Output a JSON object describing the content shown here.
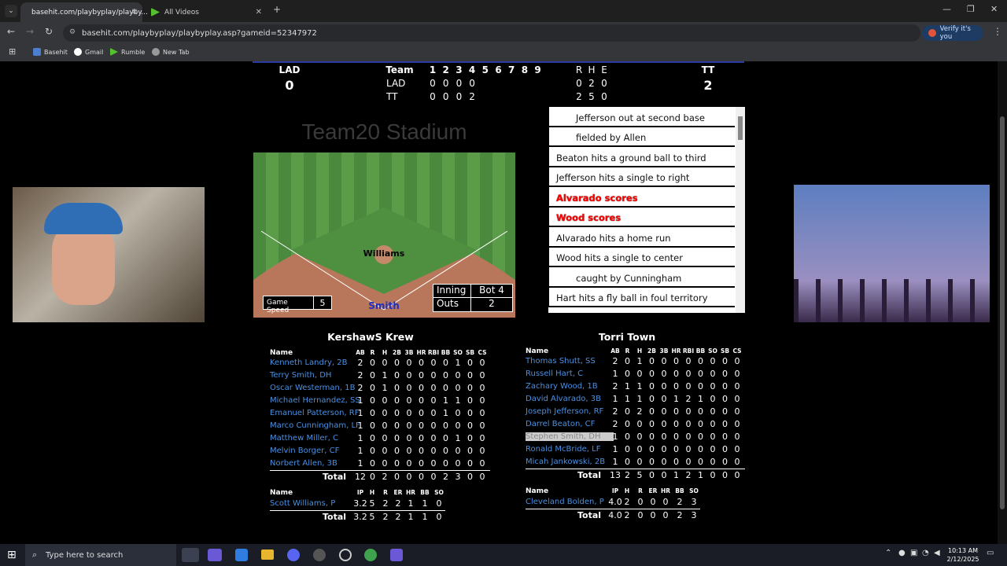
{
  "browser": {
    "tabs": [
      {
        "title": "basehit.com/playbyplay/playby...",
        "active": true
      },
      {
        "title": "All Videos",
        "active": false
      }
    ],
    "url": "basehit.com/playbyplay/playbyplay.asp?gameid=52347972",
    "verify_label": "Verify it's you",
    "bookmarks": [
      "Basehit",
      "Gmail",
      "Rumble",
      "New Tab"
    ]
  },
  "scoreboard": {
    "away_abbr": "LAD",
    "away_score": "0",
    "home_abbr": "TT",
    "home_score": "2",
    "team_header": "Team",
    "innings": [
      "1",
      "2",
      "3",
      "4",
      "5",
      "6",
      "7",
      "8",
      "9"
    ],
    "rhe_header": [
      "R",
      "H",
      "E"
    ],
    "rows": [
      {
        "team": "LAD",
        "innings": [
          "0",
          "0",
          "0",
          "0"
        ],
        "rhe": [
          "0",
          "2",
          "0"
        ]
      },
      {
        "team": "TT",
        "innings": [
          "0",
          "0",
          "0",
          "2"
        ],
        "rhe": [
          "2",
          "5",
          "0"
        ]
      }
    ]
  },
  "stadium": {
    "name": "Team20 Stadium",
    "pitcher": "Williams",
    "batter": "Smith",
    "game_speed_label": "Game Speed",
    "game_speed": "5",
    "inning_label": "Inning",
    "inning_value": "Bot 4",
    "outs_label": "Outs",
    "outs_value": "2"
  },
  "play_by_play": [
    {
      "text": "Jefferson out at second base",
      "indent": true,
      "red": false
    },
    {
      "text": "fielded by Allen",
      "indent": true,
      "red": false
    },
    {
      "text": "Beaton hits a ground ball to third",
      "indent": false,
      "red": false
    },
    {
      "text": "Jefferson hits a single to right",
      "indent": false,
      "red": false
    },
    {
      "text": "Alvarado scores",
      "indent": false,
      "red": true
    },
    {
      "text": "Wood scores",
      "indent": false,
      "red": true
    },
    {
      "text": "Alvarado hits a home run",
      "indent": false,
      "red": false
    },
    {
      "text": "Wood hits a single to center",
      "indent": false,
      "red": false
    },
    {
      "text": "caught by Cunningham",
      "indent": true,
      "red": false
    },
    {
      "text": "Hart hits a fly ball in foul territory",
      "indent": false,
      "red": false
    }
  ],
  "away_team": {
    "name": "KershawS Krew",
    "bat_headers": [
      "Name",
      "AB",
      "R",
      "H",
      "2B",
      "3B",
      "HR",
      "RBI",
      "BB",
      "SO",
      "SB",
      "CS"
    ],
    "batters": [
      {
        "name": "Kenneth Landry, 2B",
        "stats": [
          "2",
          "0",
          "0",
          "0",
          "0",
          "0",
          "0",
          "0",
          "1",
          "0",
          "0"
        ]
      },
      {
        "name": "Terry Smith, DH",
        "stats": [
          "2",
          "0",
          "1",
          "0",
          "0",
          "0",
          "0",
          "0",
          "0",
          "0",
          "0"
        ]
      },
      {
        "name": "Oscar Westerman, 1B",
        "stats": [
          "2",
          "0",
          "1",
          "0",
          "0",
          "0",
          "0",
          "0",
          "0",
          "0",
          "0"
        ]
      },
      {
        "name": "Michael Hernandez, SS",
        "stats": [
          "1",
          "0",
          "0",
          "0",
          "0",
          "0",
          "0",
          "1",
          "1",
          "0",
          "0"
        ]
      },
      {
        "name": "Emanuel Patterson, RF",
        "stats": [
          "1",
          "0",
          "0",
          "0",
          "0",
          "0",
          "0",
          "1",
          "0",
          "0",
          "0"
        ]
      },
      {
        "name": "Marco Cunningham, LF",
        "stats": [
          "1",
          "0",
          "0",
          "0",
          "0",
          "0",
          "0",
          "0",
          "0",
          "0",
          "0"
        ]
      },
      {
        "name": "Matthew Miller, C",
        "stats": [
          "1",
          "0",
          "0",
          "0",
          "0",
          "0",
          "0",
          "0",
          "1",
          "0",
          "0"
        ]
      },
      {
        "name": "Melvin Borger, CF",
        "stats": [
          "1",
          "0",
          "0",
          "0",
          "0",
          "0",
          "0",
          "0",
          "0",
          "0",
          "0"
        ]
      },
      {
        "name": "Norbert Allen, 3B",
        "stats": [
          "1",
          "0",
          "0",
          "0",
          "0",
          "0",
          "0",
          "0",
          "0",
          "0",
          "0"
        ]
      }
    ],
    "bat_total_label": "Total",
    "bat_totals": [
      "12",
      "0",
      "2",
      "0",
      "0",
      "0",
      "0",
      "2",
      "3",
      "0",
      "0"
    ],
    "pit_headers": [
      "Name",
      "IP",
      "H",
      "R",
      "ER",
      "HR",
      "BB",
      "SO"
    ],
    "pitchers": [
      {
        "name": "Scott Williams, P",
        "stats": [
          "3.2",
          "5",
          "2",
          "2",
          "1",
          "1",
          "0"
        ]
      }
    ],
    "pit_total_label": "Total",
    "pit_totals": [
      "3.2",
      "5",
      "2",
      "2",
      "1",
      "1",
      "0"
    ]
  },
  "home_team": {
    "name": "Torri Town",
    "bat_headers": [
      "Name",
      "AB",
      "R",
      "H",
      "2B",
      "3B",
      "HR",
      "RBI",
      "BB",
      "SO",
      "SB",
      "CS"
    ],
    "batters": [
      {
        "name": "Thomas Shutt, SS",
        "stats": [
          "2",
          "0",
          "1",
          "0",
          "0",
          "0",
          "0",
          "0",
          "0",
          "0",
          "0"
        ],
        "highlight": false
      },
      {
        "name": "Russell Hart, C",
        "stats": [
          "1",
          "0",
          "0",
          "0",
          "0",
          "0",
          "0",
          "0",
          "0",
          "0",
          "0"
        ],
        "highlight": false
      },
      {
        "name": "Zachary Wood, 1B",
        "stats": [
          "2",
          "1",
          "1",
          "0",
          "0",
          "0",
          "0",
          "0",
          "0",
          "0",
          "0"
        ],
        "highlight": false
      },
      {
        "name": "David Alvarado, 3B",
        "stats": [
          "1",
          "1",
          "1",
          "0",
          "0",
          "1",
          "2",
          "1",
          "0",
          "0",
          "0"
        ],
        "highlight": false
      },
      {
        "name": "Joseph Jefferson, RF",
        "stats": [
          "2",
          "0",
          "2",
          "0",
          "0",
          "0",
          "0",
          "0",
          "0",
          "0",
          "0"
        ],
        "highlight": false
      },
      {
        "name": "Darrel Beaton, CF",
        "stats": [
          "2",
          "0",
          "0",
          "0",
          "0",
          "0",
          "0",
          "0",
          "0",
          "0",
          "0"
        ],
        "highlight": false
      },
      {
        "name": "Stephen Smith, DH",
        "stats": [
          "1",
          "0",
          "0",
          "0",
          "0",
          "0",
          "0",
          "0",
          "0",
          "0",
          "0"
        ],
        "highlight": true
      },
      {
        "name": "Ronald McBride, LF",
        "stats": [
          "1",
          "0",
          "0",
          "0",
          "0",
          "0",
          "0",
          "0",
          "0",
          "0",
          "0"
        ],
        "highlight": false
      },
      {
        "name": "Micah Jankowski, 2B",
        "stats": [
          "1",
          "0",
          "0",
          "0",
          "0",
          "0",
          "0",
          "0",
          "0",
          "0",
          "0"
        ],
        "highlight": false
      }
    ],
    "bat_total_label": "Total",
    "bat_totals": [
      "13",
      "2",
      "5",
      "0",
      "0",
      "1",
      "2",
      "1",
      "0",
      "0",
      "0"
    ],
    "pit_headers": [
      "Name",
      "IP",
      "H",
      "R",
      "ER",
      "HR",
      "BB",
      "SO"
    ],
    "pitchers": [
      {
        "name": "Cleveland Bolden, P",
        "stats": [
          "4.0",
          "2",
          "0",
          "0",
          "0",
          "2",
          "3"
        ]
      }
    ],
    "pit_total_label": "Total",
    "pit_totals": [
      "4.0",
      "2",
      "0",
      "0",
      "0",
      "2",
      "3"
    ]
  },
  "taskbar": {
    "search_placeholder": "Type here to search",
    "time": "10:13 AM",
    "date": "2/12/2025"
  }
}
